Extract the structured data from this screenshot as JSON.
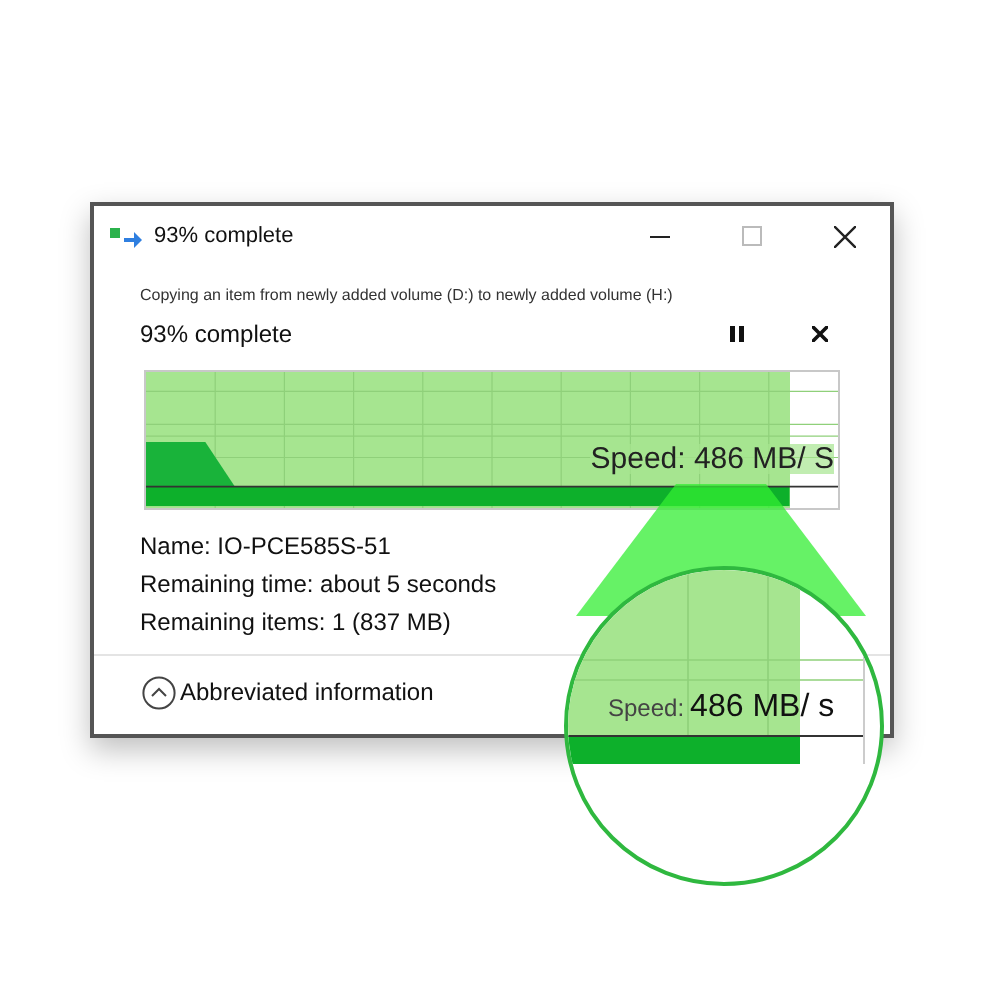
{
  "window": {
    "title": "93% complete"
  },
  "description": "Copying an item from newly added volume (D:) to newly added volume (H:)",
  "progress": {
    "heading": "93% complete",
    "level": 0.93,
    "speed": "Speed: 486 MB/ S"
  },
  "details": [
    "Name: IO-PCE585S-51",
    "Remaining time: about 5 seconds",
    "Remaining items: 1 (837 MB)"
  ],
  "toggle": {
    "label": "Abbreviated information",
    "expanded": true
  },
  "magnifier": {
    "speed_label": "Speed:",
    "speed_value": "486 MB/ s"
  }
}
